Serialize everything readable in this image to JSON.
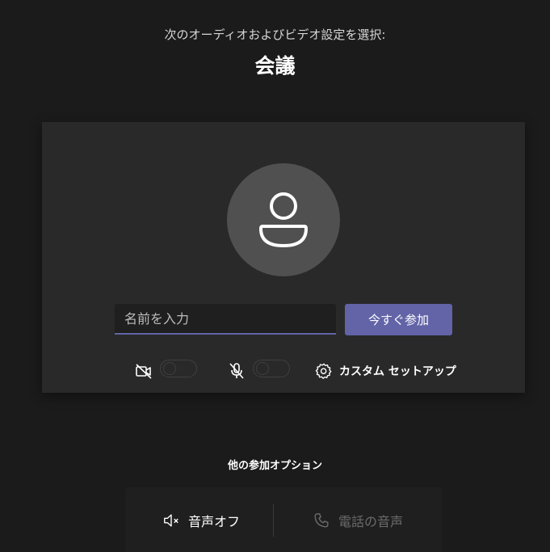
{
  "header": {
    "subtitle": "次のオーディオおよびビデオ設定を選択:",
    "title": "会議"
  },
  "prejoin": {
    "avatar_icon": "person-icon",
    "name_input": {
      "value": "",
      "placeholder": "名前を入力"
    },
    "join_button_label": "今すぐ参加",
    "camera": {
      "icon": "camera-off-icon",
      "enabled": false
    },
    "microphone": {
      "icon": "mic-off-icon",
      "enabled": false
    },
    "custom_setup": {
      "icon": "gear-icon",
      "label": "カスタム セットアップ"
    }
  },
  "other_options": {
    "title": "他の参加オプション",
    "audio_off": {
      "icon": "speaker-off-icon",
      "label": "音声オフ"
    },
    "phone_audio": {
      "icon": "phone-icon",
      "label": "電話の音声",
      "disabled": true
    }
  },
  "colors": {
    "background": "#1b1b1b",
    "card": "#292929",
    "accent": "#6264a7",
    "disabled_text": "#6b6b6b"
  }
}
